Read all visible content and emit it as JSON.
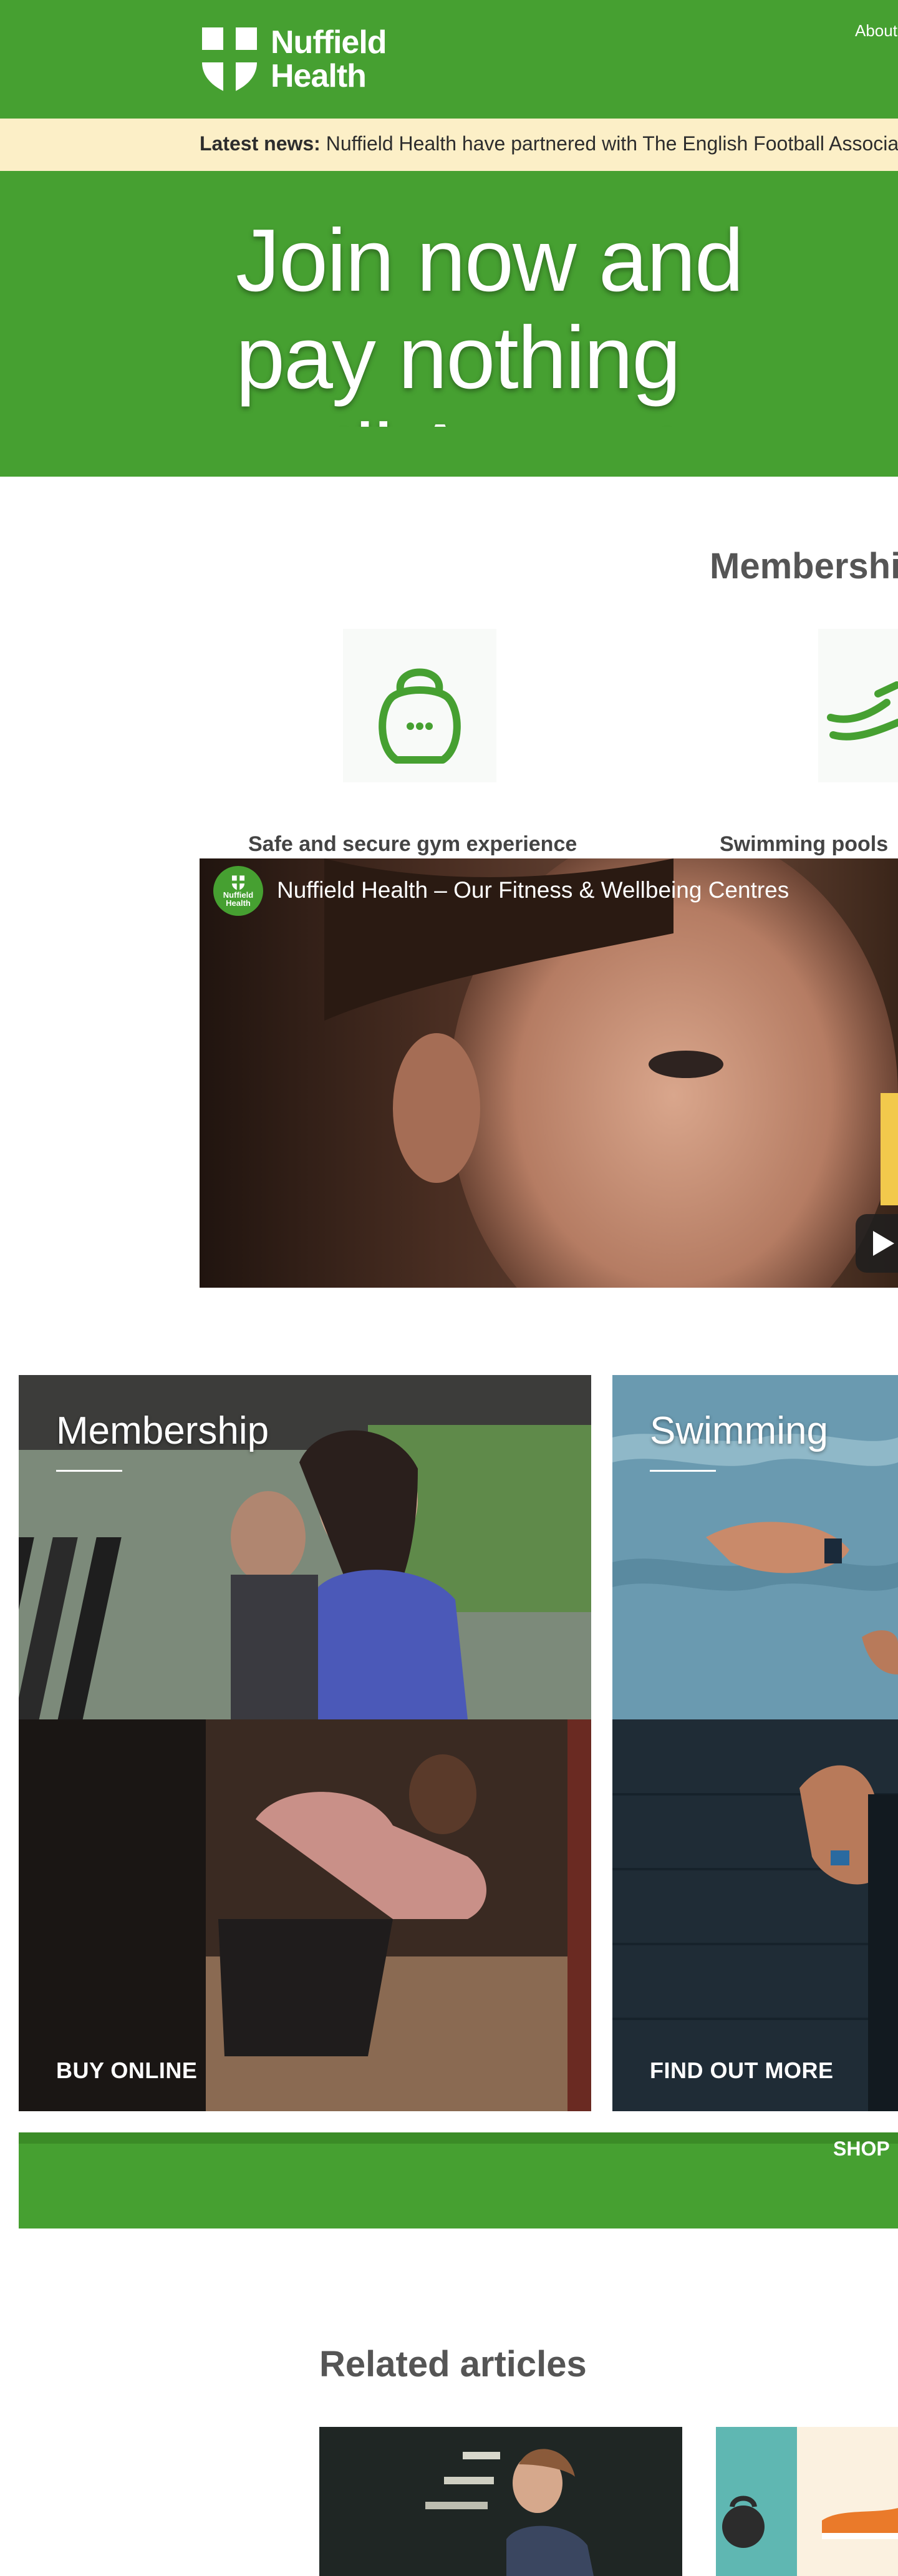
{
  "header": {
    "logo_line1": "Nuffield",
    "logo_line2": "Health",
    "nav_about": "About"
  },
  "news": {
    "label": "Latest news:",
    "text": "Nuffield Health have partnered with The English Football Association"
  },
  "hero": {
    "title": "Join now and pay nothing until August"
  },
  "benefits": {
    "title": "Membership",
    "items": [
      {
        "label": "Safe and secure gym experience",
        "icon": "kettlebell-icon"
      },
      {
        "label": "Swimming pools",
        "icon": "swimming-icon"
      }
    ]
  },
  "video": {
    "channel_logo_line1": "Nuffield",
    "channel_logo_line2": "Health",
    "title": "Nuffield Health – Our Fitness & Wellbeing Centres"
  },
  "tiles": [
    {
      "title": "Membership",
      "cta": "BUY ONLINE"
    },
    {
      "title": "Swimming",
      "cta": "FIND OUT MORE"
    }
  ],
  "band": {
    "text": "SHOP"
  },
  "related": {
    "title": "Related articles"
  },
  "colors": {
    "brand_green": "#46a031",
    "news_bg": "#fcefc7"
  }
}
